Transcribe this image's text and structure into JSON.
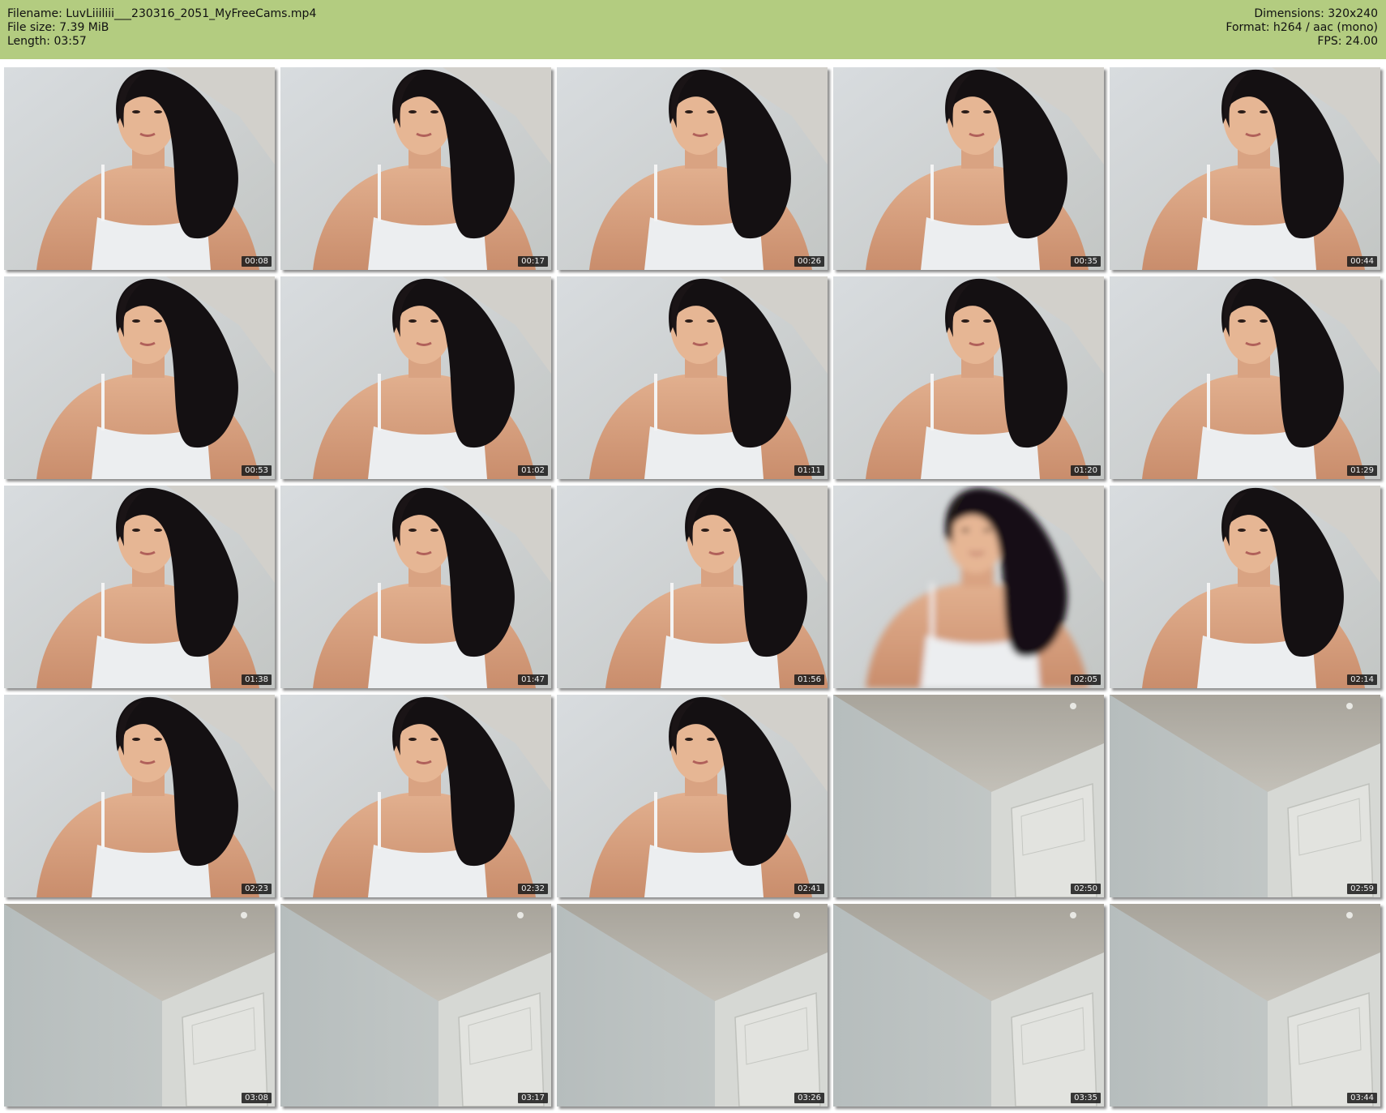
{
  "header": {
    "filename": "Filename: LuvLiiiliii___230316_2051_MyFreeCams.mp4",
    "filesize": "File size: 7.39 MiB",
    "length": "Length: 03:57",
    "dimensions": "Dimensions: 320x240",
    "format": "Format: h264 / aac (mono)",
    "fps": "FPS: 24.00",
    "background_color": "#b3cc80"
  },
  "thumbnails": [
    {
      "time": "00:08",
      "scene": "person"
    },
    {
      "time": "00:17",
      "scene": "person"
    },
    {
      "time": "00:26",
      "scene": "person"
    },
    {
      "time": "00:35",
      "scene": "person"
    },
    {
      "time": "00:44",
      "scene": "person"
    },
    {
      "time": "00:53",
      "scene": "person"
    },
    {
      "time": "01:02",
      "scene": "person"
    },
    {
      "time": "01:11",
      "scene": "person"
    },
    {
      "time": "01:20",
      "scene": "person"
    },
    {
      "time": "01:29",
      "scene": "person"
    },
    {
      "time": "01:38",
      "scene": "person"
    },
    {
      "time": "01:47",
      "scene": "person"
    },
    {
      "time": "01:56",
      "scene": "person-leaning"
    },
    {
      "time": "02:05",
      "scene": "person-blurred"
    },
    {
      "time": "02:14",
      "scene": "person"
    },
    {
      "time": "02:23",
      "scene": "person"
    },
    {
      "time": "02:32",
      "scene": "person"
    },
    {
      "time": "02:41",
      "scene": "person"
    },
    {
      "time": "02:50",
      "scene": "room"
    },
    {
      "time": "02:59",
      "scene": "room"
    },
    {
      "time": "03:08",
      "scene": "room"
    },
    {
      "time": "03:17",
      "scene": "room"
    },
    {
      "time": "03:26",
      "scene": "room"
    },
    {
      "time": "03:35",
      "scene": "room"
    },
    {
      "time": "03:44",
      "scene": "room"
    }
  ]
}
